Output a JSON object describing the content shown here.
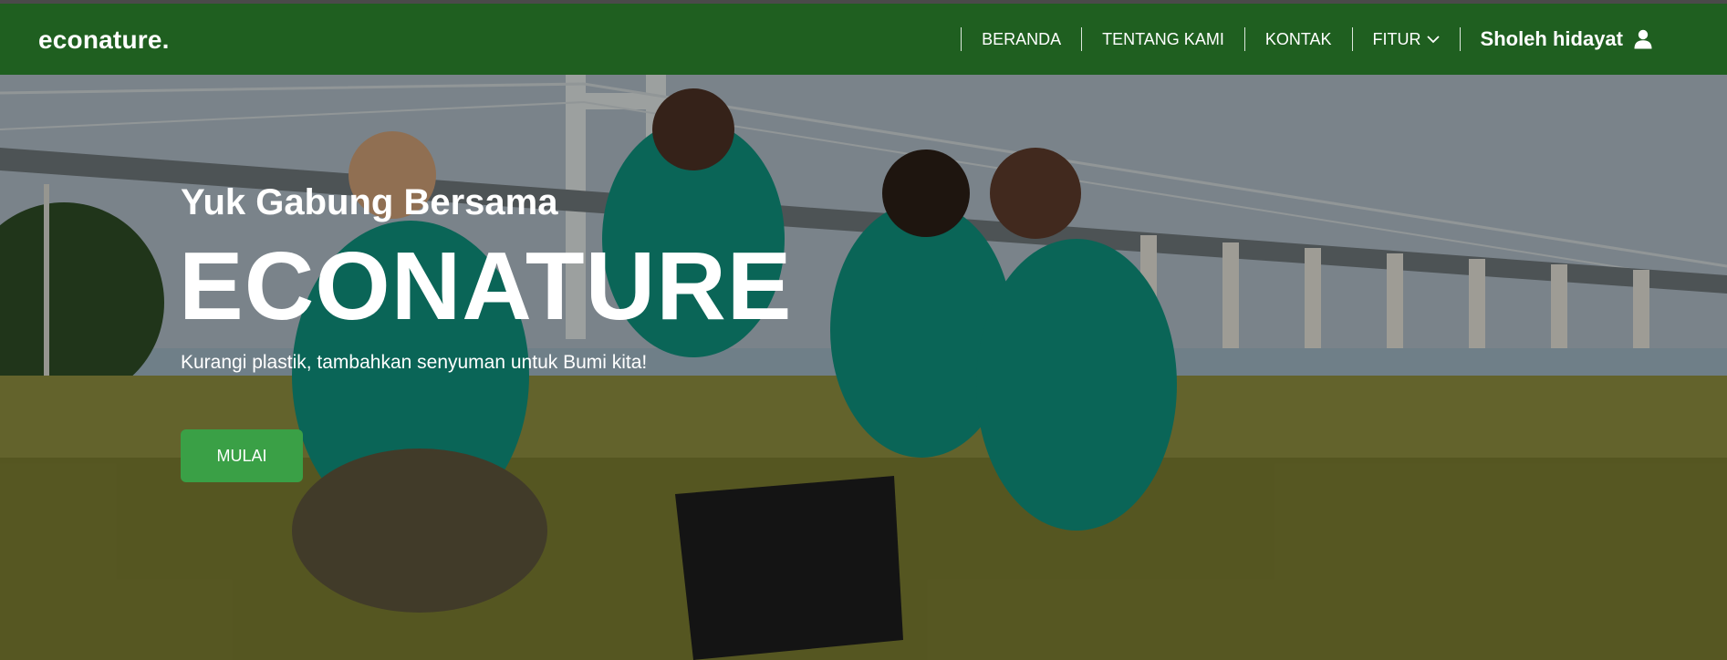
{
  "brand": "econature.",
  "nav": {
    "items": [
      {
        "label": "BERANDA"
      },
      {
        "label": "TENTANG KAMI"
      },
      {
        "label": "KONTAK"
      },
      {
        "label": "FITUR"
      }
    ],
    "user_name": "Sholeh hidayat",
    "dropdown_icon": "chevron-down-icon",
    "user_icon": "user-icon"
  },
  "hero": {
    "subtitle": "Yuk Gabung Bersama",
    "title": "ECONATURE",
    "tagline": "Kurangi plastik, tambahkan senyuman untuk Bumi kita!",
    "cta_label": "MULAI"
  },
  "colors": {
    "navbar": "#1f5f20",
    "cta": "#3aa046",
    "text": "#ffffff"
  }
}
